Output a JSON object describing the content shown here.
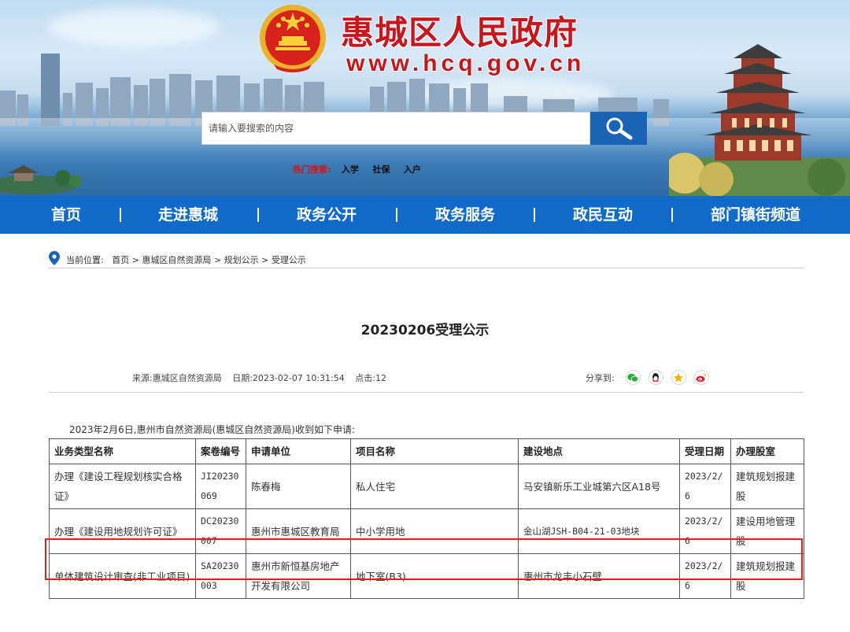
{
  "header": {
    "site_title": "惠城区人民政府",
    "site_url": "www.hcq.gov.cn",
    "search_placeholder": "请输入要搜索的内容",
    "hot_label": "热门搜索:",
    "hot_keywords": [
      "入学",
      "社保",
      "入户"
    ]
  },
  "nav": {
    "items": [
      "首页",
      "走进惠城",
      "政务公开",
      "政务服务",
      "政民互动",
      "部门镇街频道"
    ]
  },
  "breadcrumb": {
    "label": "当前位置:",
    "items": [
      "首页",
      "惠城区自然资源局",
      "规划公示",
      "受理公示"
    ],
    "separator": ">"
  },
  "article": {
    "title": "20230206受理公示",
    "source": "来源:惠城区自然资源局",
    "date": "日期:2023-02-07 10:31:54",
    "clicks": "点击:12",
    "share_label": "分享到:",
    "share_icons": [
      "wechat-icon",
      "qq-icon",
      "qzone-icon",
      "weibo-icon"
    ],
    "intro": "2023年2月6日,惠州市自然资源局(惠城区自然资源局)收到如下申请:"
  },
  "table": {
    "headers": [
      "业务类型名称",
      "案卷编号",
      "申请单位",
      "项目名称",
      "建设地点",
      "受理日期",
      "办理股室"
    ],
    "rows": [
      [
        "办理《建设工程规划核实合格证》",
        "JI20230069",
        "陈春梅",
        "私人住宅",
        "马安镇新乐工业城第六区A18号",
        "2023/2/6",
        "建筑规划报建股"
      ],
      [
        "办理《建设用地规划许可证》",
        "DC20230007",
        "惠州市惠城区教育局",
        "中小学用地",
        "金山湖JSH-B04-21-03地块",
        "2023/2/6",
        "建设用地管理股"
      ],
      [
        "单体建筑设计审查(非工业项目)",
        "SA20230003",
        "惠州市新恒基房地产开发有限公司",
        "地下室(B3)",
        "惠州市龙丰小石壁",
        "2023/2/6",
        "建筑规划报建股"
      ]
    ]
  },
  "colors": {
    "brand_red": "#c8161d",
    "nav_blue": "#0f6bc7",
    "search_blue": "#1b63b5",
    "highlight_red": "#e0201c"
  }
}
